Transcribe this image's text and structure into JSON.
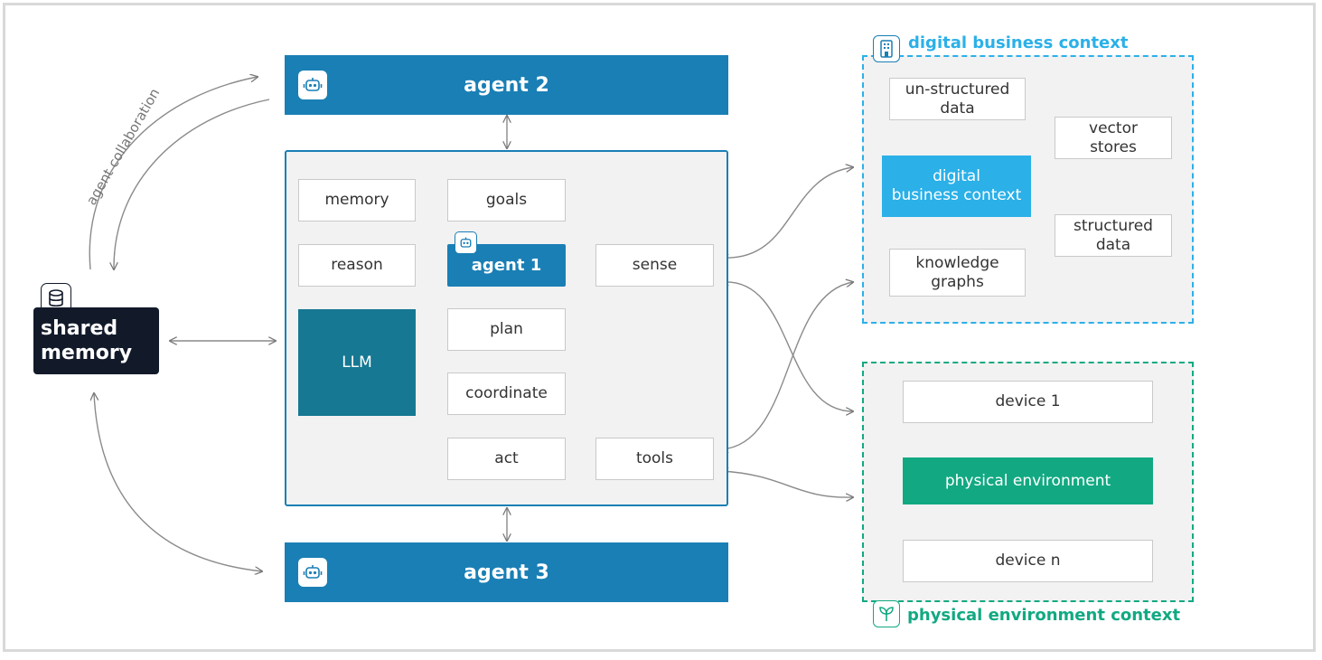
{
  "agents": {
    "agent1": "agent 1",
    "agent2": "agent 2",
    "agent3": "agent 3"
  },
  "shared_memory": {
    "line1": "shared",
    "line2": "memory"
  },
  "collaboration_label": "agent collaboration",
  "inner": {
    "memory": "memory",
    "goals": "goals",
    "reason": "reason",
    "sense": "sense",
    "llm": "LLM",
    "plan": "plan",
    "coordinate": "coordinate",
    "act": "act",
    "tools": "tools"
  },
  "digital": {
    "title": "digital business context",
    "unstructured": [
      "un-structured",
      "data"
    ],
    "vector": [
      "vector",
      "stores"
    ],
    "center": [
      "digital",
      "business context"
    ],
    "structured": [
      "structured",
      "data"
    ],
    "knowledge": [
      "knowledge",
      "graphs"
    ]
  },
  "physical": {
    "title": "physical environment context",
    "device1": "device 1",
    "center": "physical environment",
    "devicen": "device n"
  },
  "colors": {
    "agent_blue": "#1a7fb5",
    "llm_teal": "#167892",
    "digital_cyan": "#2bb0e8",
    "physical_green": "#12a982",
    "memory_dark": "#121a2a"
  },
  "icons": {
    "agent": "robot-icon",
    "memory": "database-icon",
    "digital": "building-icon",
    "physical": "leaf-icon"
  }
}
